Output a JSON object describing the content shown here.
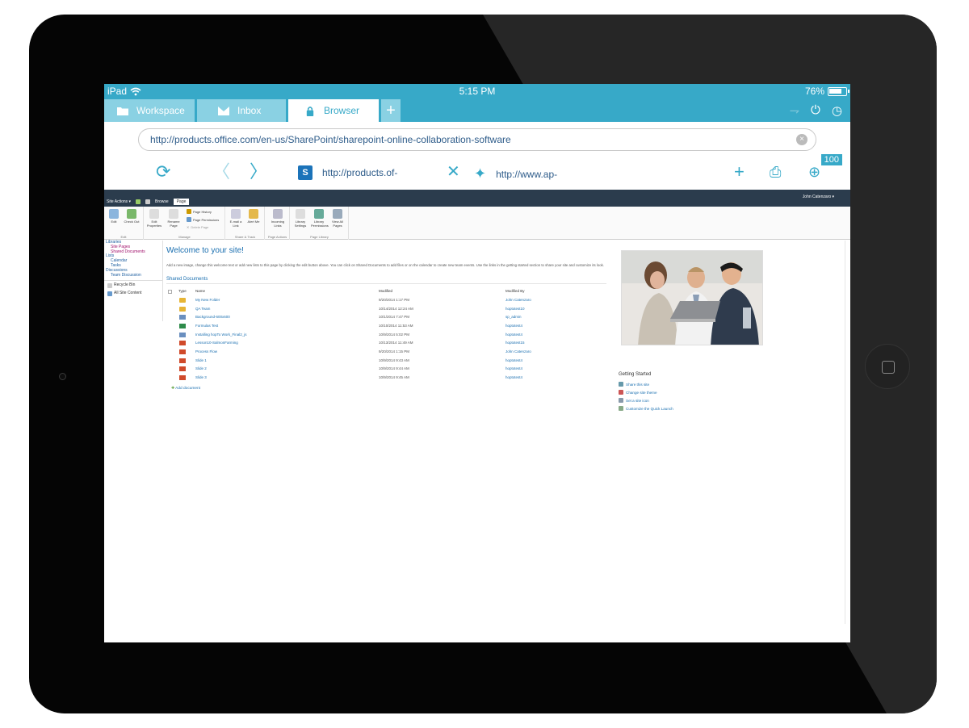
{
  "status": {
    "carrier": "iPad",
    "time": "5:15 PM",
    "battery": "76%"
  },
  "tabs": [
    {
      "label": "Workspace",
      "icon": "folder-icon"
    },
    {
      "label": "Inbox",
      "icon": "inbox-icon"
    },
    {
      "label": "Browser",
      "icon": "lock-icon"
    }
  ],
  "url": "http://products.office.com/en-us/SharePoint/sharepoint-online-collaboration-software",
  "browser_tabs": [
    {
      "label": "http://products.of-",
      "icon": "sharepoint-icon"
    },
    {
      "label": "http://www.ap-",
      "icon": "star-icon"
    }
  ],
  "download_count": "100",
  "sp": {
    "site_actions": "Site Actions ▾",
    "browse_tab": "Browse",
    "page_tab": "Page",
    "user": "John Catenzaro ▾",
    "ribbon": {
      "edit": "Edit",
      "check_out": "Check Out",
      "edit_properties": "Edit Properties",
      "rename_page": "Rename Page",
      "page_history": "Page History",
      "page_permissions": "Page Permissions",
      "delete_page": "Delete Page",
      "email_link": "E-mail a Link",
      "alert_me": "Alert Me",
      "incoming_links": "Incoming Links",
      "library_settings": "Library Settings",
      "library_permissions": "Library Permissions",
      "view_all_pages": "View All Pages",
      "group_edit": "Edit",
      "group_manage": "Manage",
      "group_share": "Share & Track",
      "group_actions": "Page Actions",
      "group_library": "Page Library"
    },
    "leftnav": {
      "libraries": "Libraries",
      "site_pages": "Site Pages",
      "shared_documents": "Shared Documents",
      "lists": "Lists",
      "calendar": "Calendar",
      "tasks": "Tasks",
      "discussions": "Discussions",
      "team_discussion": "Team Discussion",
      "recycle_bin": "Recycle Bin",
      "all_site_content": "All Site Content"
    },
    "welcome": "Welcome to your site!",
    "description": "Add a new image, change this welcome text or add new lists to this page by clicking the edit button above. You can click on Shared Documents to add files or on the calendar to create new team events. Use the links in the getting started section to share your site and customize its look.",
    "shared_docs_title": "Shared Documents",
    "columns": {
      "type": "Type",
      "name": "Name",
      "modified": "Modified",
      "modified_by": "Modified By"
    },
    "documents": [
      {
        "type": "folder",
        "name": "My New Folder",
        "modified": "9/20/2014 1:17 PM",
        "by": "John Catenzaro"
      },
      {
        "type": "folder",
        "name": "QA Team",
        "modified": "10/14/2014 12:24 AM",
        "by": "hoptotest10"
      },
      {
        "type": "img",
        "name": "Background-600x600",
        "modified": "10/1/2014 7:47 PM",
        "by": "sp_admin"
      },
      {
        "type": "xls",
        "name": "Formulas Test",
        "modified": "10/10/2014 11:53 AM",
        "by": "hoptotest4"
      },
      {
        "type": "img",
        "name": "Installing hopTo Work_Final2_js",
        "modified": "10/9/2014 5:02 PM",
        "by": "hoptotest4"
      },
      {
        "type": "ppt",
        "name": "Lesson10-SalmonFarming",
        "modified": "10/13/2014 11:49 AM",
        "by": "hoptotest15"
      },
      {
        "type": "ppt",
        "name": "Process Flow",
        "modified": "9/20/2014 1:15 PM",
        "by": "John Catenzaro"
      },
      {
        "type": "ppt",
        "name": "Slide 1",
        "modified": "10/9/2014 9:43 AM",
        "by": "hoptotest4"
      },
      {
        "type": "ppt",
        "name": "Slide 2",
        "modified": "10/9/2014 9:44 AM",
        "by": "hoptotest4"
      },
      {
        "type": "ppt",
        "name": "Slide 3",
        "modified": "10/9/2014 9:45 AM",
        "by": "hoptotest4"
      }
    ],
    "add_document": "Add document",
    "getting_started": {
      "title": "Getting Started",
      "items": [
        {
          "label": "Share this site",
          "icon": "share-icon"
        },
        {
          "label": "Change site theme",
          "icon": "theme-icon"
        },
        {
          "label": "Set a site icon",
          "icon": "site-icon"
        },
        {
          "label": "Customize the Quick Launch",
          "icon": "quick-launch-icon"
        }
      ]
    }
  },
  "colors": {
    "accent": "#37a9c8",
    "tab_inactive": "#8ad1e3",
    "sp_bar": "#2b3c4d",
    "link": "#1a6fb0"
  }
}
